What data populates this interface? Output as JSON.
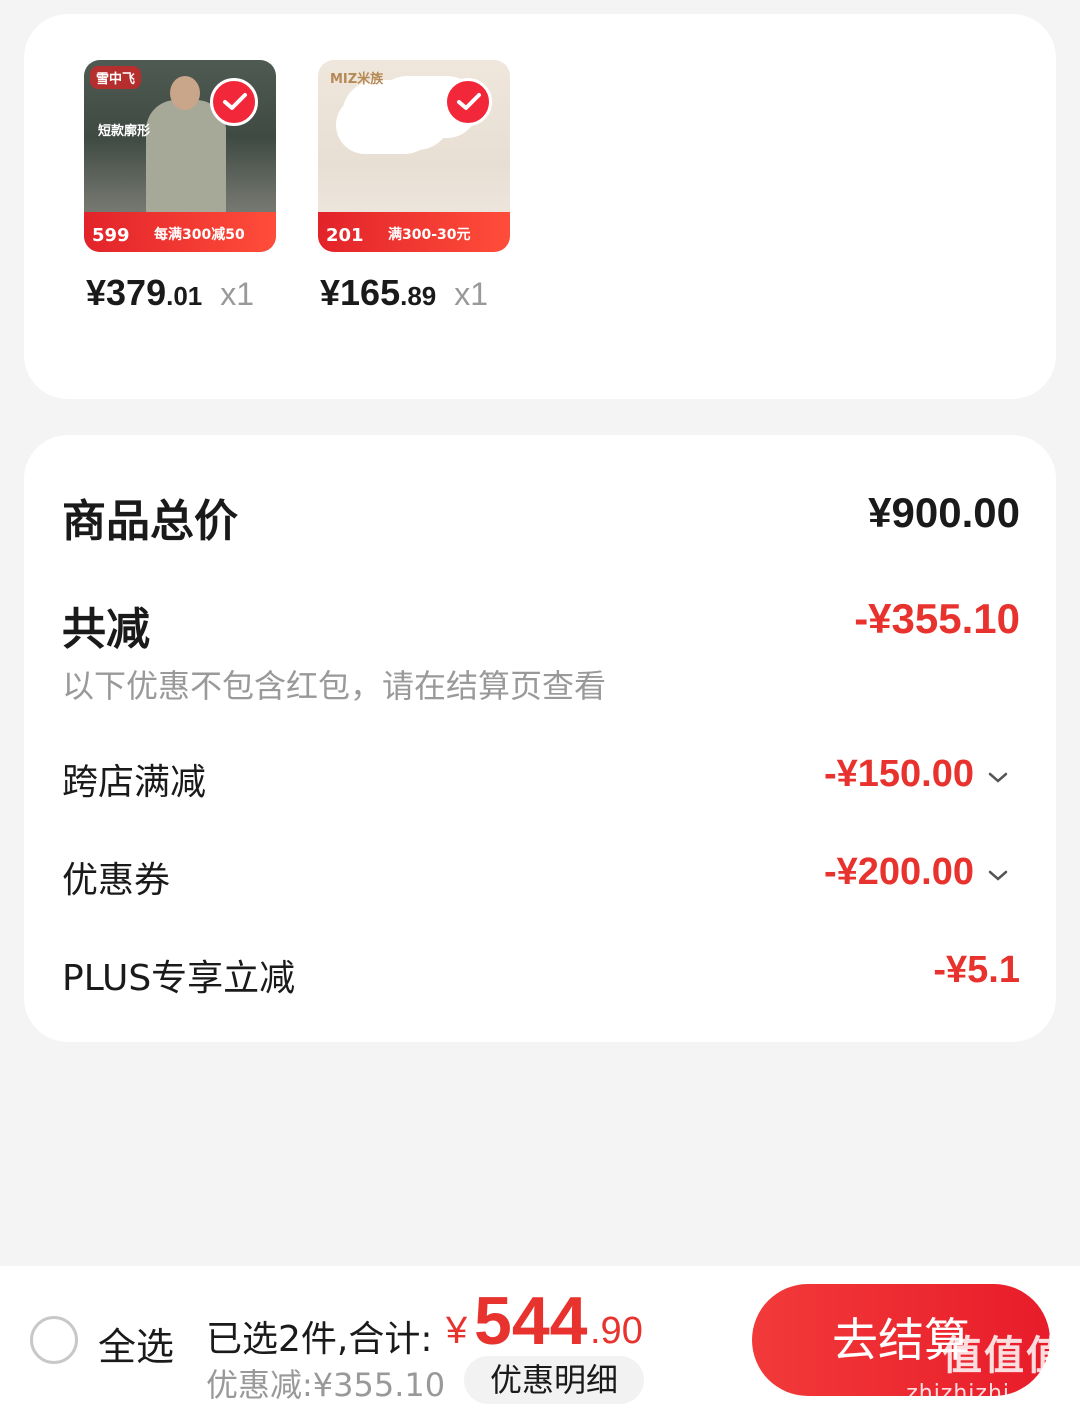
{
  "products": [
    {
      "thumb_brand": "雪中飞",
      "thumb_caption": "短款廓形",
      "thumb_promo_price": "599",
      "thumb_promo_text": "每满300减50",
      "price_int": "¥379",
      "price_dec": ".01",
      "qty": "x1",
      "selected": true
    },
    {
      "thumb_brand": "MIZ米族",
      "thumb_caption": "",
      "thumb_promo_price": "201",
      "thumb_promo_text": "满300-30元",
      "price_int": "¥165",
      "price_dec": ".89",
      "qty": "x1",
      "selected": true
    }
  ],
  "summary": {
    "total_label": "商品总价",
    "total_value": "¥900.00",
    "reduce_label": "共减",
    "reduce_value": "-¥355.10",
    "note": "以下优惠不包含红包，请在结算页查看",
    "items": [
      {
        "label": "跨店满减",
        "value": "-¥150.00",
        "expandable": true
      },
      {
        "label": "优惠券",
        "value": "-¥200.00",
        "expandable": true
      },
      {
        "label": "PLUS专享立减",
        "value": "-¥5.1",
        "expandable": false
      }
    ]
  },
  "bottom": {
    "select_all": "全选",
    "selected_text": "已选2件,合计:",
    "total_symbol": "¥",
    "total_int": "544",
    "total_dec": ".90",
    "discount_text": "优惠减:¥355.10",
    "detail_button": "优惠明细",
    "checkout_button": "去结算"
  },
  "watermark": {
    "main": "值值值",
    "sub": "zhizhizhi.com"
  },
  "colors": {
    "accent": "#e8322e",
    "check": "#f2273a",
    "background": "#f4f4f4"
  }
}
